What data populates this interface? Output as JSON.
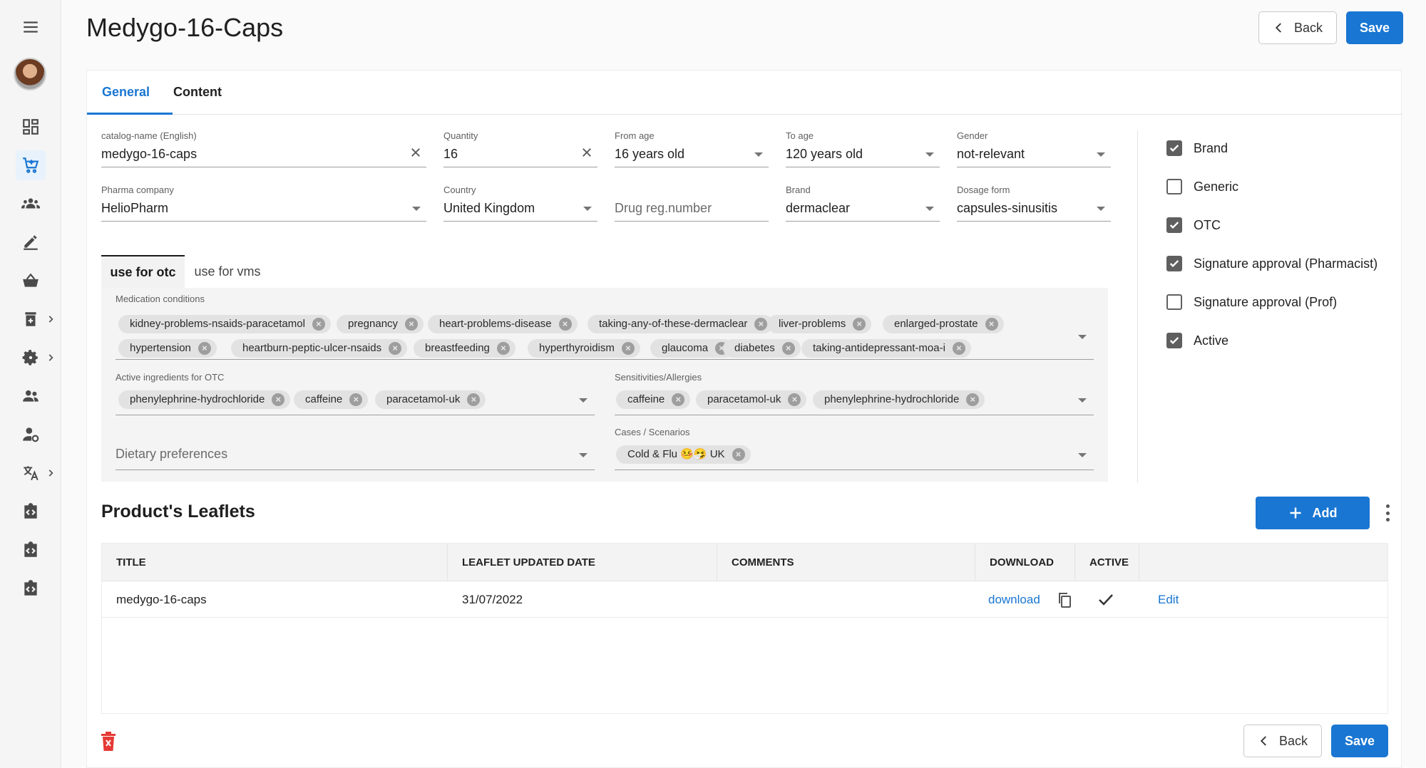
{
  "page": {
    "title": "Medygo-16-Caps"
  },
  "header": {
    "back_label": "Back",
    "save_label": "Save"
  },
  "tabs": [
    {
      "label": "General",
      "active": true
    },
    {
      "label": "Content",
      "active": false
    }
  ],
  "fields": {
    "catalog_name": {
      "label": "catalog-name (English)",
      "value": "medygo-16-caps"
    },
    "quantity": {
      "label": "Quantity",
      "value": "16"
    },
    "from_age": {
      "label": "From age",
      "value": "16 years old"
    },
    "to_age": {
      "label": "To age",
      "value": "120 years old"
    },
    "gender": {
      "label": "Gender",
      "value": "not-relevant"
    },
    "pharma_company": {
      "label": "Pharma company",
      "value": "HelioPharm"
    },
    "country": {
      "label": "Country",
      "value": "United Kingdom"
    },
    "drug_reg": {
      "placeholder": "Drug reg.number"
    },
    "brand": {
      "label": "Brand",
      "value": "dermaclear"
    },
    "dosage_form": {
      "label": "Dosage form",
      "value": "capsules-sinusitis"
    }
  },
  "subtabs": [
    {
      "label": "use for otc",
      "active": true
    },
    {
      "label": "use for vms",
      "active": false
    }
  ],
  "medication_conditions": {
    "label": "Medication conditions",
    "chips": [
      "kidney-problems-nsaids-paracetamol",
      "pregnancy",
      "heart-problems-disease",
      "taking-any-of-these-dermaclear",
      "liver-problems",
      "enlarged-prostate",
      "hypertension",
      "heartburn-peptic-ulcer-nsaids",
      "breastfeeding",
      "hyperthyroidism",
      "glaucoma",
      "diabetes",
      "taking-antidepressant-moa-i"
    ]
  },
  "active_ingredients": {
    "label": "Active ingredients for OTC",
    "chips": [
      "phenylephrine-hydrochloride",
      "caffeine",
      "paracetamol-uk"
    ]
  },
  "sensitivities": {
    "label": "Sensitivities/Allergies",
    "chips": [
      "caffeine",
      "paracetamol-uk",
      "phenylephrine-hydrochloride"
    ]
  },
  "dietary": {
    "placeholder": "Dietary preferences"
  },
  "cases": {
    "label": "Cases / Scenarios",
    "chips": [
      "Cold & Flu 🤒🤧 UK"
    ]
  },
  "checkboxes": [
    {
      "label": "Brand",
      "checked": true
    },
    {
      "label": "Generic",
      "checked": false
    },
    {
      "label": "OTC",
      "checked": true
    },
    {
      "label": "Signature approval (Pharmacist)",
      "checked": true
    },
    {
      "label": "Signature approval (Prof)",
      "checked": false
    },
    {
      "label": "Active",
      "checked": true
    }
  ],
  "leaflets": {
    "title": "Product's Leaflets",
    "add_label": "Add",
    "columns": [
      "TITLE",
      "LEAFLET UPDATED DATE",
      "COMMENTS",
      "DOWNLOAD",
      "ACTIVE"
    ],
    "rows": [
      {
        "title": "medygo-16-caps",
        "date": "31/07/2022",
        "comments": "",
        "download": "download",
        "active": true,
        "edit": "Edit"
      }
    ]
  },
  "footer": {
    "back_label": "Back",
    "save_label": "Save"
  }
}
